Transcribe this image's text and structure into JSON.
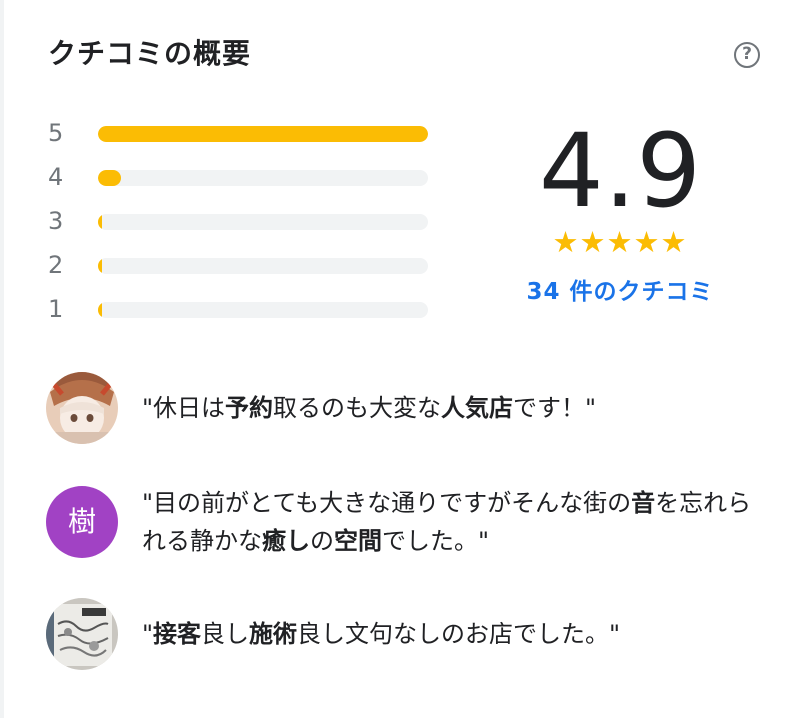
{
  "header": {
    "title": "クチコミの概要",
    "help_icon": "help-circle-icon",
    "help_glyph": "?"
  },
  "rating": {
    "distribution": [
      {
        "stars": "5",
        "fraction": 1.0
      },
      {
        "stars": "4",
        "fraction": 0.07
      },
      {
        "stars": "3",
        "fraction": 0.01
      },
      {
        "stars": "2",
        "fraction": 0.01
      },
      {
        "stars": "1",
        "fraction": 0.01
      }
    ],
    "average": "4.9",
    "stars_display": "★★★★★",
    "count_label": "34 件のクチコミ"
  },
  "reviews": [
    {
      "avatar_type": "photo",
      "segments": [
        {
          "t": "\"休日は",
          "b": false
        },
        {
          "t": "予約",
          "b": true
        },
        {
          "t": "取るのも大変な",
          "b": false
        },
        {
          "t": "人気店",
          "b": true
        },
        {
          "t": "です！\"",
          "b": false
        }
      ]
    },
    {
      "avatar_type": "letter",
      "avatar_letter": "樹",
      "segments": [
        {
          "t": "\"目の前がとても大きな通りですがそんな街の",
          "b": false
        },
        {
          "t": "音",
          "b": true
        },
        {
          "t": "を忘れられる静かな",
          "b": false
        },
        {
          "t": "癒し",
          "b": true
        },
        {
          "t": "の",
          "b": false
        },
        {
          "t": "空間",
          "b": true
        },
        {
          "t": "でした。\"",
          "b": false
        }
      ]
    },
    {
      "avatar_type": "photo",
      "segments": [
        {
          "t": "\"",
          "b": false
        },
        {
          "t": "接客",
          "b": true
        },
        {
          "t": "良し",
          "b": false
        },
        {
          "t": "施術",
          "b": true
        },
        {
          "t": "良し文句なしのお店でした。\"",
          "b": false
        }
      ]
    }
  ],
  "colors": {
    "star": "#fbbc04",
    "link": "#1a73e8",
    "avatar_purple": "#a142c4",
    "track": "#f1f3f4"
  }
}
